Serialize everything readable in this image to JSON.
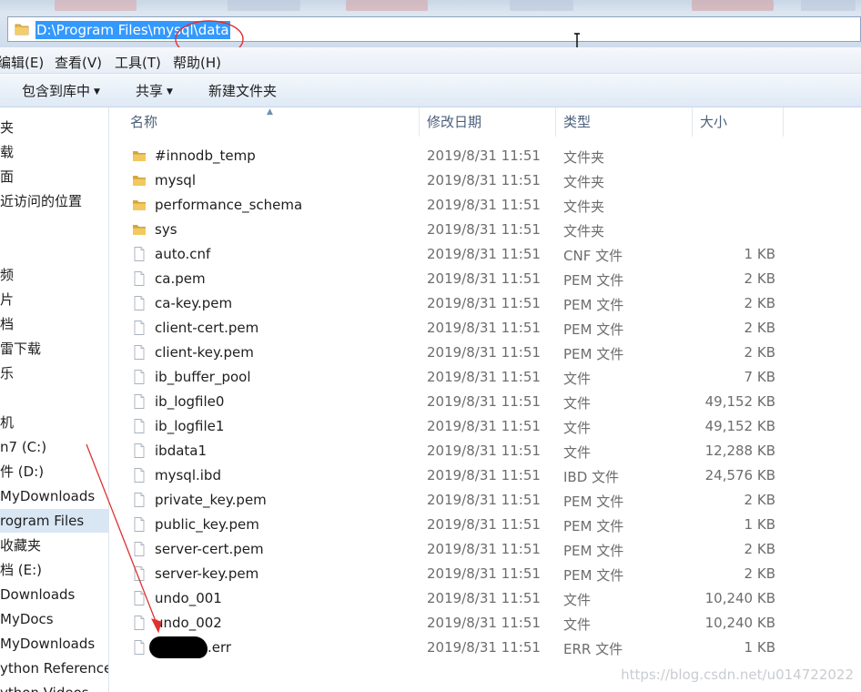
{
  "address_bar": {
    "path": "D:\\Program Files\\mysql\\data"
  },
  "menu": [
    {
      "label": "编辑(E)"
    },
    {
      "label": "查看(V)"
    },
    {
      "label": "工具(T)"
    },
    {
      "label": "帮助(H)"
    }
  ],
  "toolbar": {
    "include_library": "包含到库中",
    "share": "共享",
    "new_folder": "新建文件夹"
  },
  "nav": [
    {
      "label": "夹"
    },
    {
      "label": "载"
    },
    {
      "label": "面"
    },
    {
      "label": "近访问的位置"
    },
    {
      "label": "频"
    },
    {
      "label": "片"
    },
    {
      "label": "档"
    },
    {
      "label": "雷下载"
    },
    {
      "label": "乐"
    },
    {
      "label": "机"
    },
    {
      "label": "n7 (C:)"
    },
    {
      "label": "件 (D:)"
    },
    {
      "label": "MyDownloads"
    },
    {
      "label": "rogram Files"
    },
    {
      "label": "收藏夹"
    },
    {
      "label": "档 (E:)"
    },
    {
      "label": "Downloads"
    },
    {
      "label": "MyDocs"
    },
    {
      "label": "MyDownloads"
    },
    {
      "label": "ython Reference"
    },
    {
      "label": "ython Videos"
    }
  ],
  "columns": {
    "name": "名称",
    "date": "修改日期",
    "type": "类型",
    "size": "大小"
  },
  "files": [
    {
      "name": "#innodb_temp",
      "date": "2019/8/31 11:51",
      "type": "文件夹",
      "size": "",
      "icon": "folder-icon"
    },
    {
      "name": "mysql",
      "date": "2019/8/31 11:51",
      "type": "文件夹",
      "size": "",
      "icon": "folder-icon"
    },
    {
      "name": "performance_schema",
      "date": "2019/8/31 11:51",
      "type": "文件夹",
      "size": "",
      "icon": "folder-icon"
    },
    {
      "name": "sys",
      "date": "2019/8/31 11:51",
      "type": "文件夹",
      "size": "",
      "icon": "folder-icon"
    },
    {
      "name": "auto.cnf",
      "date": "2019/8/31 11:51",
      "type": "CNF 文件",
      "size": "1 KB",
      "icon": "file-icon"
    },
    {
      "name": "ca.pem",
      "date": "2019/8/31 11:51",
      "type": "PEM 文件",
      "size": "2 KB",
      "icon": "file-icon"
    },
    {
      "name": "ca-key.pem",
      "date": "2019/8/31 11:51",
      "type": "PEM 文件",
      "size": "2 KB",
      "icon": "file-icon"
    },
    {
      "name": "client-cert.pem",
      "date": "2019/8/31 11:51",
      "type": "PEM 文件",
      "size": "2 KB",
      "icon": "file-icon"
    },
    {
      "name": "client-key.pem",
      "date": "2019/8/31 11:51",
      "type": "PEM 文件",
      "size": "2 KB",
      "icon": "file-icon"
    },
    {
      "name": "ib_buffer_pool",
      "date": "2019/8/31 11:51",
      "type": "文件",
      "size": "7 KB",
      "icon": "file-icon"
    },
    {
      "name": "ib_logfile0",
      "date": "2019/8/31 11:51",
      "type": "文件",
      "size": "49,152 KB",
      "icon": "file-icon"
    },
    {
      "name": "ib_logfile1",
      "date": "2019/8/31 11:51",
      "type": "文件",
      "size": "49,152 KB",
      "icon": "file-icon"
    },
    {
      "name": "ibdata1",
      "date": "2019/8/31 11:51",
      "type": "文件",
      "size": "12,288 KB",
      "icon": "file-icon"
    },
    {
      "name": "mysql.ibd",
      "date": "2019/8/31 11:51",
      "type": "IBD 文件",
      "size": "24,576 KB",
      "icon": "file-icon"
    },
    {
      "name": "private_key.pem",
      "date": "2019/8/31 11:51",
      "type": "PEM 文件",
      "size": "2 KB",
      "icon": "file-icon"
    },
    {
      "name": "public_key.pem",
      "date": "2019/8/31 11:51",
      "type": "PEM 文件",
      "size": "1 KB",
      "icon": "file-icon"
    },
    {
      "name": "server-cert.pem",
      "date": "2019/8/31 11:51",
      "type": "PEM 文件",
      "size": "2 KB",
      "icon": "file-icon"
    },
    {
      "name": "server-key.pem",
      "date": "2019/8/31 11:51",
      "type": "PEM 文件",
      "size": "2 KB",
      "icon": "file-icon"
    },
    {
      "name": "undo_001",
      "date": "2019/8/31 11:51",
      "type": "文件",
      "size": "10,240 KB",
      "icon": "file-icon"
    },
    {
      "name": "undo_002",
      "date": "2019/8/31 11:51",
      "type": "文件",
      "size": "10,240 KB",
      "icon": "file-icon"
    },
    {
      "name": ".err",
      "date": "2019/8/31 11:51",
      "type": "ERR 文件",
      "size": "1 KB",
      "icon": "file-icon",
      "redacted": true
    }
  ],
  "watermark": "https://blog.csdn.net/u014722022",
  "colors": {
    "selection": "#3399ff",
    "annotation": "#e03030",
    "folder": "#e8b84a"
  }
}
